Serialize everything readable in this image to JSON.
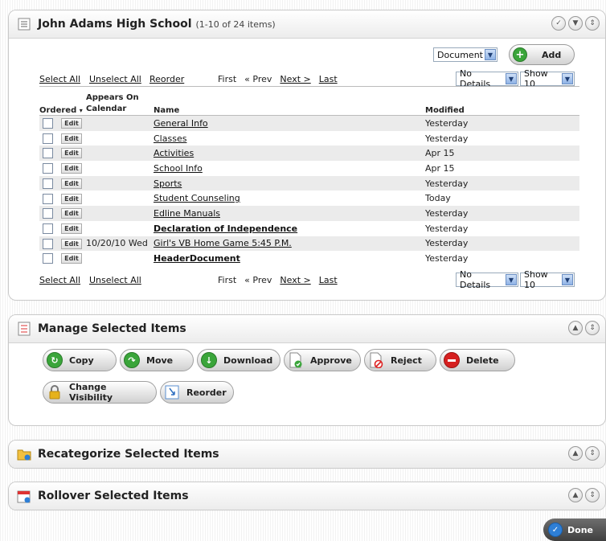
{
  "panel1": {
    "title": "John Adams High School",
    "count": "(1-10 of 24 items)",
    "add_type_select": "Document",
    "add_label": "Add",
    "toolbar": {
      "select_all": "Select All",
      "unselect_all": "Unselect All",
      "reorder": "Reorder",
      "first": "First",
      "prev": "« Prev",
      "next": "Next >",
      "last": "Last",
      "details_select": "No Details",
      "show_select": "Show 10"
    },
    "columns": {
      "ordered": "Ordered",
      "appears_on_calendar": "Appears On Calendar",
      "name": "Name",
      "modified": "Modified"
    },
    "edit_label": "Edit",
    "rows": [
      {
        "calendar": "",
        "name": "General Info",
        "modified": "Yesterday"
      },
      {
        "calendar": "",
        "name": "Classes",
        "modified": "Yesterday"
      },
      {
        "calendar": "",
        "name": "Activities",
        "modified": "Apr 15"
      },
      {
        "calendar": "",
        "name": "School Info",
        "modified": "Apr 15"
      },
      {
        "calendar": "",
        "name": "Sports",
        "modified": "Yesterday"
      },
      {
        "calendar": "",
        "name": "Student Counseling",
        "modified": "Today"
      },
      {
        "calendar": "",
        "name": "Edline Manuals",
        "modified": "Yesterday"
      },
      {
        "calendar": "",
        "name": "Declaration of Independence",
        "modified": "Yesterday"
      },
      {
        "calendar": "10/20/10 Wed",
        "name": "Girl's VB Home Game 5:45 P.M.",
        "modified": "Yesterday"
      },
      {
        "calendar": "",
        "name": "HeaderDocument",
        "modified": "Yesterday"
      }
    ]
  },
  "manage": {
    "title": "Manage Selected Items",
    "buttons": {
      "copy": "Copy",
      "move": "Move",
      "download": "Download",
      "approve": "Approve",
      "reject": "Reject",
      "delete": "Delete",
      "change_visibility": "Change Visibility",
      "reorder": "Reorder"
    }
  },
  "recategorize": {
    "title": "Recategorize Selected Items"
  },
  "rollover": {
    "title": "Rollover Selected Items"
  },
  "done_label": "Done"
}
